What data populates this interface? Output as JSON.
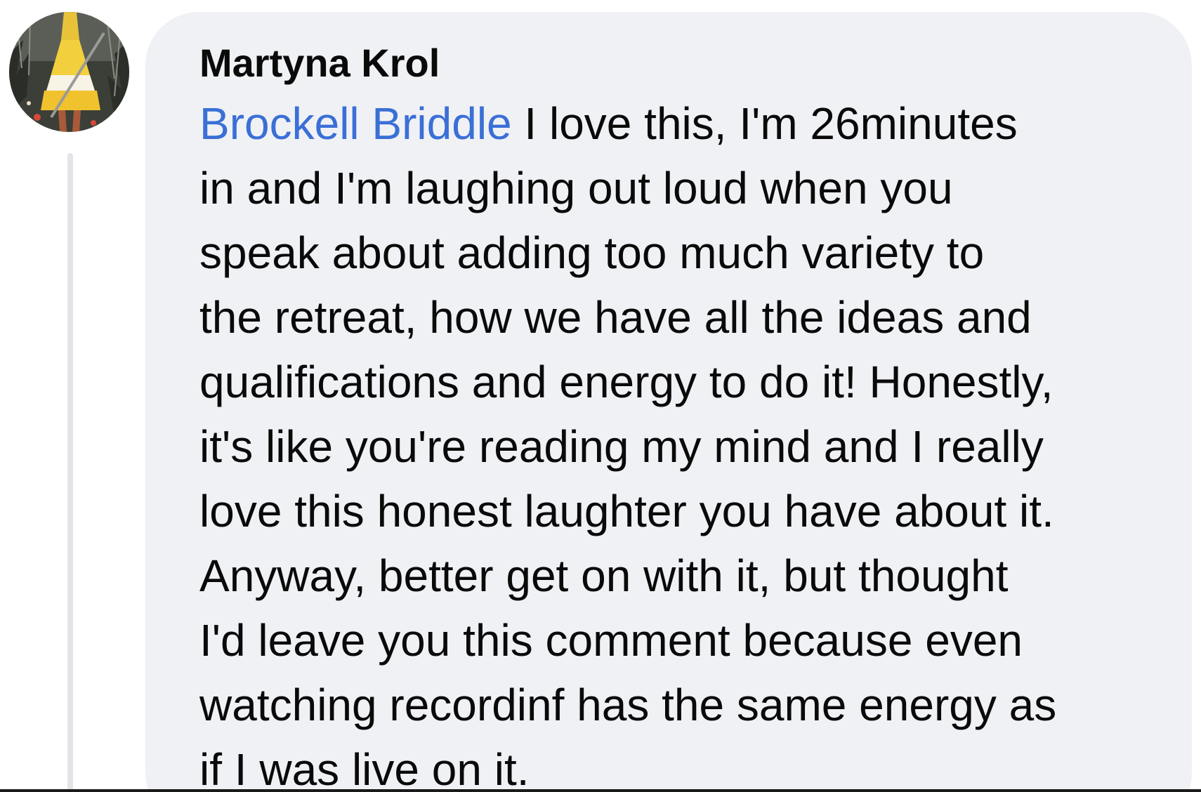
{
  "comment": {
    "author": "Martyna Krol",
    "mention": "Brockell Briddle",
    "lines": [
      " I love this, I'm 26minutes",
      "in and I'm laughing out loud when you",
      "speak about adding too much variety to",
      "the retreat, how we have all the ideas and",
      "qualifications and energy to do it! Honestly,",
      "it's like you're reading my mind and I really",
      "love this honest laughter you have about it.",
      "Anyway, better get on with it, but thought",
      "I'd leave you this comment because even",
      "watching recordinf has the same energy as",
      "if I was live on it."
    ]
  },
  "icons": {
    "avatar": "profile-photo-avatar"
  },
  "colors": {
    "bubble": "#f0f1f5",
    "mention": "#3a6fd6",
    "text": "#0a0a0a",
    "thread_line": "#e3e4e8"
  }
}
